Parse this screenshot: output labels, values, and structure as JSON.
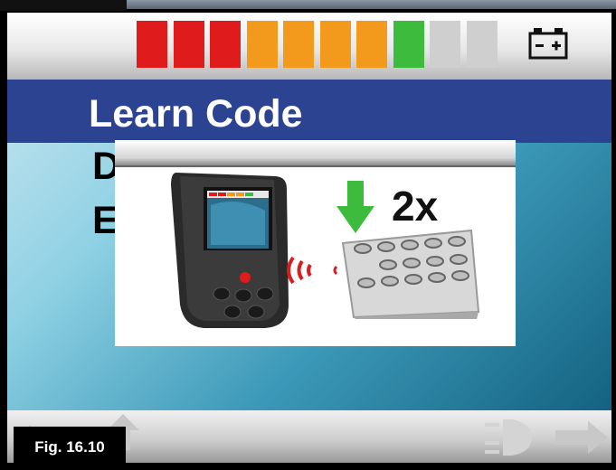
{
  "title": "Learn Code",
  "menu_items": [
    "D",
    "E"
  ],
  "battery": {
    "level_segments": 8,
    "total_segments": 10,
    "colors": [
      "#e01b1b",
      "#e01b1b",
      "#e01b1b",
      "#f39a1d",
      "#f39a1d",
      "#f39a1d",
      "#f39a1d",
      "#3dbb3d",
      "#cfcfcf",
      "#cfcfcf"
    ]
  },
  "popup": {
    "press_count": "2x"
  },
  "figure_label": "Fig. 16.10",
  "icons": [
    "battery-icon",
    "back-arrow-icon",
    "up-arrow-icon",
    "headlight-icon",
    "forward-arrow-icon",
    "joystick-icon",
    "keypad-icon",
    "signal-icon",
    "press-down-icon"
  ]
}
